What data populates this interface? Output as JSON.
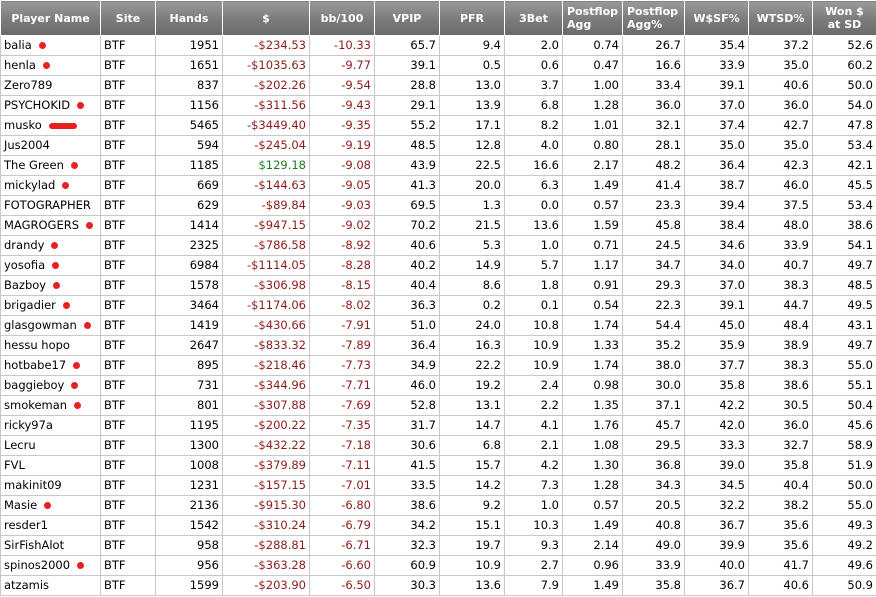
{
  "columns": [
    "Player Name",
    "Site",
    "Hands",
    "$",
    "bb/100",
    "VPIP",
    "PFR",
    "3Bet",
    "Postflop Agg",
    "Postflop Agg%",
    "W$SF%",
    "WTSD%",
    "Won $ at SD"
  ],
  "colors": {
    "negative": "#8b1a1a",
    "positive": "#1f7a1f",
    "marker": "#e82020",
    "header_bg": "#7a7a7a"
  },
  "rows": [
    {
      "name": "balia",
      "site": "BTF",
      "hands": "1951",
      "money": "-$234.53",
      "bb": "-10.33",
      "vpip": "65.7",
      "pfr": "9.4",
      "threebet": "2.0",
      "agg": "0.74",
      "aggpct": "26.7",
      "wsf": "35.4",
      "wtsd": "37.2",
      "wsd": "52.6",
      "mark": "dot"
    },
    {
      "name": "henla",
      "site": "BTF",
      "hands": "1651",
      "money": "-$1035.63",
      "bb": "-9.77",
      "vpip": "39.1",
      "pfr": "0.5",
      "threebet": "0.6",
      "agg": "0.47",
      "aggpct": "16.6",
      "wsf": "33.9",
      "wtsd": "35.0",
      "wsd": "60.2",
      "mark": "dot"
    },
    {
      "name": "Zero789",
      "site": "BTF",
      "hands": "837",
      "money": "-$202.26",
      "bb": "-9.54",
      "vpip": "28.8",
      "pfr": "13.0",
      "threebet": "3.7",
      "agg": "1.00",
      "aggpct": "33.4",
      "wsf": "39.1",
      "wtsd": "40.6",
      "wsd": "50.0",
      "mark": ""
    },
    {
      "name": "PSYCHOKID",
      "site": "BTF",
      "hands": "1156",
      "money": "-$311.56",
      "bb": "-9.43",
      "vpip": "29.1",
      "pfr": "13.9",
      "threebet": "6.8",
      "agg": "1.28",
      "aggpct": "36.0",
      "wsf": "37.0",
      "wtsd": "36.0",
      "wsd": "54.0",
      "mark": "dot"
    },
    {
      "name": "musko",
      "site": "BTF",
      "hands": "5465",
      "money": "-$3449.40",
      "bb": "-9.35",
      "vpip": "55.2",
      "pfr": "17.1",
      "threebet": "8.2",
      "agg": "1.01",
      "aggpct": "32.1",
      "wsf": "37.4",
      "wtsd": "42.7",
      "wsd": "47.8",
      "mark": "wide"
    },
    {
      "name": "Jus2004",
      "site": "BTF",
      "hands": "594",
      "money": "-$245.04",
      "bb": "-9.19",
      "vpip": "48.5",
      "pfr": "12.8",
      "threebet": "4.0",
      "agg": "0.80",
      "aggpct": "28.1",
      "wsf": "35.0",
      "wtsd": "35.0",
      "wsd": "53.4",
      "mark": ""
    },
    {
      "name": "The Green",
      "site": "BTF",
      "hands": "1185",
      "money": "$129.18",
      "bb": "-9.08",
      "vpip": "43.9",
      "pfr": "22.5",
      "threebet": "16.6",
      "agg": "2.17",
      "aggpct": "48.2",
      "wsf": "36.4",
      "wtsd": "42.3",
      "wsd": "42.1",
      "mark": "dot"
    },
    {
      "name": "mickylad",
      "site": "BTF",
      "hands": "669",
      "money": "-$144.63",
      "bb": "-9.05",
      "vpip": "41.3",
      "pfr": "20.0",
      "threebet": "6.3",
      "agg": "1.49",
      "aggpct": "41.4",
      "wsf": "38.7",
      "wtsd": "46.0",
      "wsd": "45.5",
      "mark": "dot"
    },
    {
      "name": "FOTOGRAPHER",
      "site": "BTF",
      "hands": "629",
      "money": "-$89.84",
      "bb": "-9.03",
      "vpip": "69.5",
      "pfr": "1.3",
      "threebet": "0.0",
      "agg": "0.57",
      "aggpct": "23.3",
      "wsf": "39.4",
      "wtsd": "37.5",
      "wsd": "53.4",
      "mark": ""
    },
    {
      "name": "MAGROGERS",
      "site": "BTF",
      "hands": "1414",
      "money": "-$947.15",
      "bb": "-9.02",
      "vpip": "70.2",
      "pfr": "21.5",
      "threebet": "13.6",
      "agg": "1.59",
      "aggpct": "45.8",
      "wsf": "38.4",
      "wtsd": "48.0",
      "wsd": "38.6",
      "mark": "dot"
    },
    {
      "name": "drandy",
      "site": "BTF",
      "hands": "2325",
      "money": "-$786.58",
      "bb": "-8.92",
      "vpip": "40.6",
      "pfr": "5.3",
      "threebet": "1.0",
      "agg": "0.71",
      "aggpct": "24.5",
      "wsf": "34.6",
      "wtsd": "33.9",
      "wsd": "54.1",
      "mark": "dot"
    },
    {
      "name": "yosofia",
      "site": "BTF",
      "hands": "6984",
      "money": "-$1114.05",
      "bb": "-8.28",
      "vpip": "40.2",
      "pfr": "14.9",
      "threebet": "5.7",
      "agg": "1.17",
      "aggpct": "34.7",
      "wsf": "34.0",
      "wtsd": "40.7",
      "wsd": "49.7",
      "mark": "dot"
    },
    {
      "name": "Bazboy",
      "site": "BTF",
      "hands": "1578",
      "money": "-$306.98",
      "bb": "-8.15",
      "vpip": "40.4",
      "pfr": "8.6",
      "threebet": "1.8",
      "agg": "0.91",
      "aggpct": "29.3",
      "wsf": "37.0",
      "wtsd": "38.3",
      "wsd": "48.5",
      "mark": "dot"
    },
    {
      "name": "brigadier",
      "site": "BTF",
      "hands": "3464",
      "money": "-$1174.06",
      "bb": "-8.02",
      "vpip": "36.3",
      "pfr": "0.2",
      "threebet": "0.1",
      "agg": "0.54",
      "aggpct": "22.3",
      "wsf": "39.1",
      "wtsd": "44.7",
      "wsd": "49.5",
      "mark": "dot"
    },
    {
      "name": "glasgowman",
      "site": "BTF",
      "hands": "1419",
      "money": "-$430.66",
      "bb": "-7.91",
      "vpip": "51.0",
      "pfr": "24.0",
      "threebet": "10.8",
      "agg": "1.74",
      "aggpct": "54.4",
      "wsf": "45.0",
      "wtsd": "48.4",
      "wsd": "43.1",
      "mark": "dot"
    },
    {
      "name": "hessu hopo",
      "site": "BTF",
      "hands": "2647",
      "money": "-$833.32",
      "bb": "-7.89",
      "vpip": "36.4",
      "pfr": "16.3",
      "threebet": "10.9",
      "agg": "1.33",
      "aggpct": "35.2",
      "wsf": "35.9",
      "wtsd": "38.9",
      "wsd": "49.7",
      "mark": ""
    },
    {
      "name": "hotbabe17",
      "site": "BTF",
      "hands": "895",
      "money": "-$218.46",
      "bb": "-7.73",
      "vpip": "34.9",
      "pfr": "22.2",
      "threebet": "10.9",
      "agg": "1.74",
      "aggpct": "38.0",
      "wsf": "37.7",
      "wtsd": "38.3",
      "wsd": "55.0",
      "mark": "dot"
    },
    {
      "name": "baggieboy",
      "site": "BTF",
      "hands": "731",
      "money": "-$344.96",
      "bb": "-7.71",
      "vpip": "46.0",
      "pfr": "19.2",
      "threebet": "2.4",
      "agg": "0.98",
      "aggpct": "30.0",
      "wsf": "35.8",
      "wtsd": "38.6",
      "wsd": "55.1",
      "mark": "dot"
    },
    {
      "name": "smokeman",
      "site": "BTF",
      "hands": "801",
      "money": "-$307.88",
      "bb": "-7.69",
      "vpip": "52.8",
      "pfr": "13.1",
      "threebet": "2.2",
      "agg": "1.35",
      "aggpct": "37.1",
      "wsf": "42.2",
      "wtsd": "30.5",
      "wsd": "50.4",
      "mark": "dot"
    },
    {
      "name": "ricky97a",
      "site": "BTF",
      "hands": "1195",
      "money": "-$200.22",
      "bb": "-7.35",
      "vpip": "31.7",
      "pfr": "14.7",
      "threebet": "4.1",
      "agg": "1.76",
      "aggpct": "45.7",
      "wsf": "42.0",
      "wtsd": "36.0",
      "wsd": "45.6",
      "mark": ""
    },
    {
      "name": "Lecru",
      "site": "BTF",
      "hands": "1300",
      "money": "-$432.22",
      "bb": "-7.18",
      "vpip": "30.6",
      "pfr": "6.8",
      "threebet": "2.1",
      "agg": "1.08",
      "aggpct": "29.5",
      "wsf": "33.3",
      "wtsd": "32.7",
      "wsd": "58.9",
      "mark": ""
    },
    {
      "name": "FVL",
      "site": "BTF",
      "hands": "1008",
      "money": "-$379.89",
      "bb": "-7.11",
      "vpip": "41.5",
      "pfr": "15.7",
      "threebet": "4.2",
      "agg": "1.30",
      "aggpct": "36.8",
      "wsf": "39.0",
      "wtsd": "35.8",
      "wsd": "51.9",
      "mark": ""
    },
    {
      "name": "makinit09",
      "site": "BTF",
      "hands": "1231",
      "money": "-$157.15",
      "bb": "-7.01",
      "vpip": "33.5",
      "pfr": "14.2",
      "threebet": "7.3",
      "agg": "1.28",
      "aggpct": "34.3",
      "wsf": "34.5",
      "wtsd": "40.4",
      "wsd": "50.0",
      "mark": ""
    },
    {
      "name": "Masie",
      "site": "BTF",
      "hands": "2136",
      "money": "-$915.30",
      "bb": "-6.80",
      "vpip": "38.6",
      "pfr": "9.2",
      "threebet": "1.0",
      "agg": "0.57",
      "aggpct": "20.5",
      "wsf": "32.2",
      "wtsd": "38.2",
      "wsd": "55.0",
      "mark": "dot"
    },
    {
      "name": "resder1",
      "site": "BTF",
      "hands": "1542",
      "money": "-$310.24",
      "bb": "-6.79",
      "vpip": "34.2",
      "pfr": "15.1",
      "threebet": "10.3",
      "agg": "1.49",
      "aggpct": "40.8",
      "wsf": "36.7",
      "wtsd": "35.6",
      "wsd": "49.3",
      "mark": ""
    },
    {
      "name": "SirFishAlot",
      "site": "BTF",
      "hands": "958",
      "money": "-$288.81",
      "bb": "-6.71",
      "vpip": "32.3",
      "pfr": "19.7",
      "threebet": "9.3",
      "agg": "2.14",
      "aggpct": "49.0",
      "wsf": "39.9",
      "wtsd": "35.6",
      "wsd": "49.2",
      "mark": ""
    },
    {
      "name": "spinos2000",
      "site": "BTF",
      "hands": "956",
      "money": "-$363.28",
      "bb": "-6.60",
      "vpip": "60.9",
      "pfr": "10.9",
      "threebet": "2.7",
      "agg": "0.96",
      "aggpct": "33.9",
      "wsf": "40.0",
      "wtsd": "41.7",
      "wsd": "49.6",
      "mark": "dot"
    },
    {
      "name": "atzamis",
      "site": "BTF",
      "hands": "1599",
      "money": "-$203.90",
      "bb": "-6.50",
      "vpip": "30.3",
      "pfr": "13.6",
      "threebet": "7.9",
      "agg": "1.49",
      "aggpct": "35.8",
      "wsf": "36.7",
      "wtsd": "40.6",
      "wsd": "50.9",
      "mark": ""
    }
  ]
}
